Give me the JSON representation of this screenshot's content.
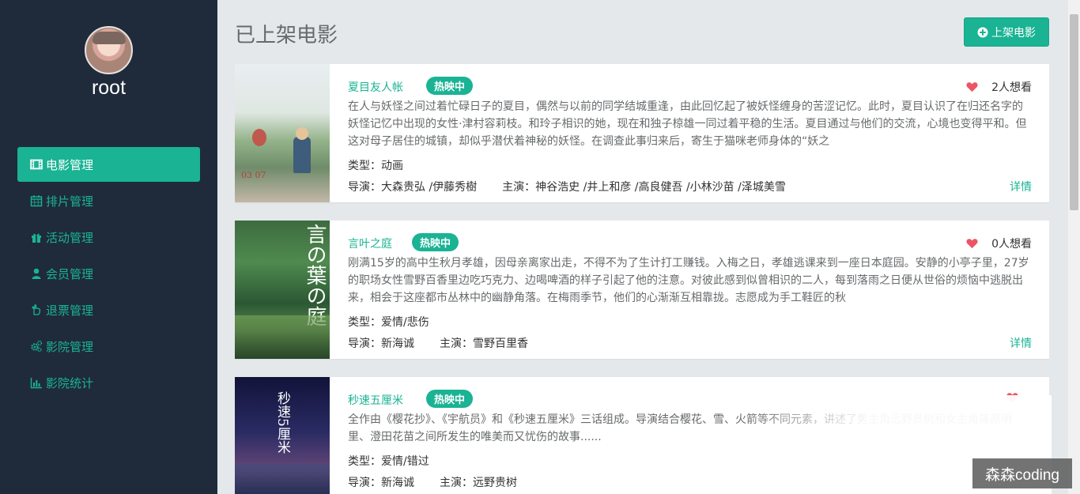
{
  "sidebar": {
    "username": "root",
    "items": [
      {
        "label": "电影管理",
        "icon": "film-icon",
        "active": true
      },
      {
        "label": "排片管理",
        "icon": "calendar-icon",
        "active": false
      },
      {
        "label": "活动管理",
        "icon": "gift-icon",
        "active": false
      },
      {
        "label": "会员管理",
        "icon": "user-icon",
        "active": false
      },
      {
        "label": "退票管理",
        "icon": "hand-icon",
        "active": false
      },
      {
        "label": "影院管理",
        "icon": "gears-icon",
        "active": false
      },
      {
        "label": "影院统计",
        "icon": "bar-chart-icon",
        "active": false
      }
    ]
  },
  "header": {
    "title": "已上架电影",
    "add_button_label": "上架电影"
  },
  "movies": [
    {
      "title": "夏目友人帐",
      "status": "热映中",
      "want_count": "2人想看",
      "description": "在人与妖怪之间过着忙碌日子的夏目，偶然与以前的同学结城重逢，由此回忆起了被妖怪缠身的苦涩记忆。此时，夏目认识了在归还名字的妖怪记忆中出现的女性·津村容莉枝。和玲子相识的她，现在和独子椋雄一同过着平稳的生活。夏目通过与他们的交流，心境也变得平和。但这对母子居住的城镇，却似乎潜伏着神秘的妖怪。在调查此事归来后，寄生于猫咪老师身体的“妖之",
      "type": "类型：动画",
      "director": "导演：大森贵弘 /伊藤秀樹",
      "cast": "主演：神谷浩史 /井上和彦 /高良健吾 /小林沙苗 /泽城美雪",
      "detail_label": "详情",
      "poster_text": "03 07"
    },
    {
      "title": "言叶之庭",
      "status": "热映中",
      "want_count": "0人想看",
      "description": "刚满15岁的高中生秋月孝雄，因母亲离家出走，不得不为了生计打工赚钱。入梅之日，孝雄逃课来到一座日本庭园。安静的小亭子里，27岁的职场女性雪野百香里边吃巧克力、边喝啤酒的样子引起了他的注意。对彼此感到似曾相识的二人，每到落雨之日便从世俗的烦恼中逃脱出来，相会于这座都市丛林中的幽静角落。在梅雨季节，他们的心渐渐互相靠拢。志愿成为手工鞋匠的秋",
      "type": "类型：爱情/悲伤",
      "director": "导演：新海诚",
      "cast": "主演：雪野百里香",
      "detail_label": "详情",
      "poster_text": "言の葉の庭"
    },
    {
      "title": "秒速五厘米",
      "status": "热映中",
      "want_count": "",
      "description": "全作由《樱花抄》、《宇航员》和《秒速五厘米》三话组成。导演结合樱花、雪、火箭等不同元素，讲述了男主角远野贵树和女主角篠原明里、澄田花苗之间所发生的唯美而又忧伤的故事......",
      "type": "类型：爱情/错过",
      "director": "导演：新海诚",
      "cast": "主演：远野贵树",
      "detail_label": "",
      "poster_text": "秒速5厘米"
    }
  ],
  "watermark": "森森coding",
  "colors": {
    "sidebar_bg": "#1f2b3a",
    "accent": "#1ab394",
    "page_bg": "#e5e8eb",
    "heart": "#ed5565"
  }
}
